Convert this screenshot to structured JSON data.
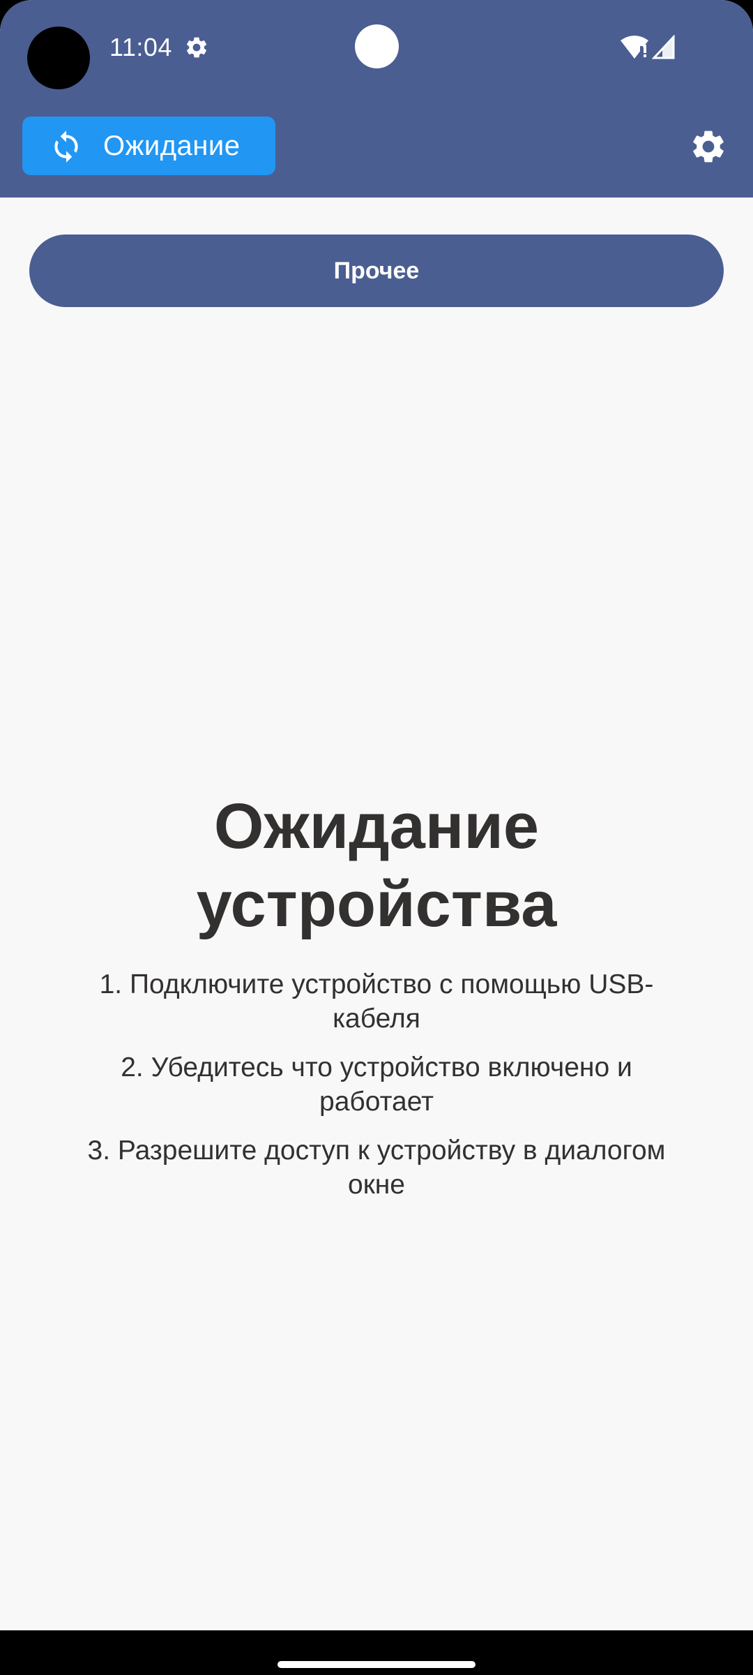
{
  "status_bar": {
    "time": "11:04",
    "icons": [
      "camera-cutout",
      "settings-gear-icon",
      "wifi-alert-icon",
      "cellular-signal-icon"
    ]
  },
  "app_bar": {
    "status_chip": {
      "label": "Ожидание",
      "icon": "sync-icon",
      "color": "#2196f3"
    },
    "settings_icon": "settings-icon",
    "background_color": "#4a5e92"
  },
  "other_button": {
    "label": "Прочее"
  },
  "main": {
    "title": "Ожидание устройства",
    "instructions": [
      "1. Подключите устройство с помощью USB-кабеля",
      "2. Убедитесь что устройство включено и работает",
      "3. Разрешите доступ к устройству в диалогом окне"
    ]
  },
  "colors": {
    "primary": "#4a5e92",
    "accent": "#2196f3",
    "background": "#f8f8f8",
    "text": "#333030"
  }
}
